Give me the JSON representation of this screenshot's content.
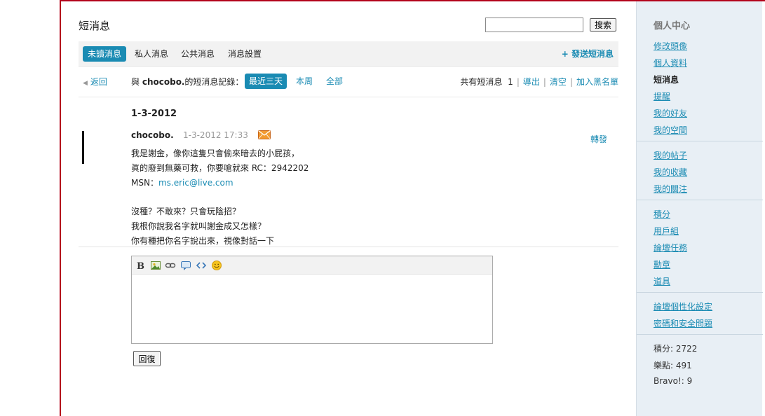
{
  "header": {
    "title": "短消息",
    "search_placeholder": "",
    "search_button": "搜索"
  },
  "tabs": [
    {
      "label": "未讀消息",
      "active": true
    },
    {
      "label": "私人消息",
      "active": false
    },
    {
      "label": "公共消息",
      "active": false
    },
    {
      "label": "消息設置",
      "active": false
    }
  ],
  "send_link": "+ 發送短消息",
  "toolbar": {
    "back": "返回",
    "history_prefix": "與",
    "history_user": "chocobo.",
    "history_suffix": "的短消息記錄：",
    "ranges": [
      {
        "label": "最近三天",
        "active": true
      },
      {
        "label": "本周",
        "active": false
      },
      {
        "label": "全部",
        "active": false
      }
    ],
    "count_label": "共有短消息",
    "count_value": "1",
    "actions": [
      "導出",
      "清空",
      "加入黑名單"
    ]
  },
  "message": {
    "date": "1-3-2012",
    "sender": "chocobo.",
    "time": "1-3-2012 17:33",
    "forward": "轉發",
    "lines": [
      "我是謝金，像你這隻只會偷來暗去的小屁孩，",
      "眞的廢到無藥可救，你要嗆就來 RC：2942202",
      "",
      "",
      "沒種？不敢來？只會玩陰招？",
      "我根你說我名字就叫謝金成又怎樣？",
      "你有種把你名字說出來，視像對話一下"
    ],
    "msn_label": "MSN：",
    "msn_value": "ms.eric@live.com"
  },
  "editor": {
    "value": "",
    "reply_button": "回復"
  },
  "sidebar": {
    "title": "個人中心",
    "group1": [
      "修改頭像",
      "個人資料",
      "短消息",
      "提醒",
      "我的好友",
      "我的空間"
    ],
    "current": "短消息",
    "group2": [
      "我的帖子",
      "我的收藏",
      "我的關注"
    ],
    "group3": [
      "積分",
      "用戶組",
      "論壇任務",
      "勳章",
      "道具"
    ],
    "group4": [
      "論壇個性化設定",
      "密碼和安全問題"
    ],
    "stats": [
      "積分: 2722",
      "樂點: 491",
      "Bravo!: 9"
    ]
  },
  "colors": {
    "accent": "#1a8bb3",
    "frame": "#b3001b",
    "sidebar_bg": "#e8eff5"
  }
}
